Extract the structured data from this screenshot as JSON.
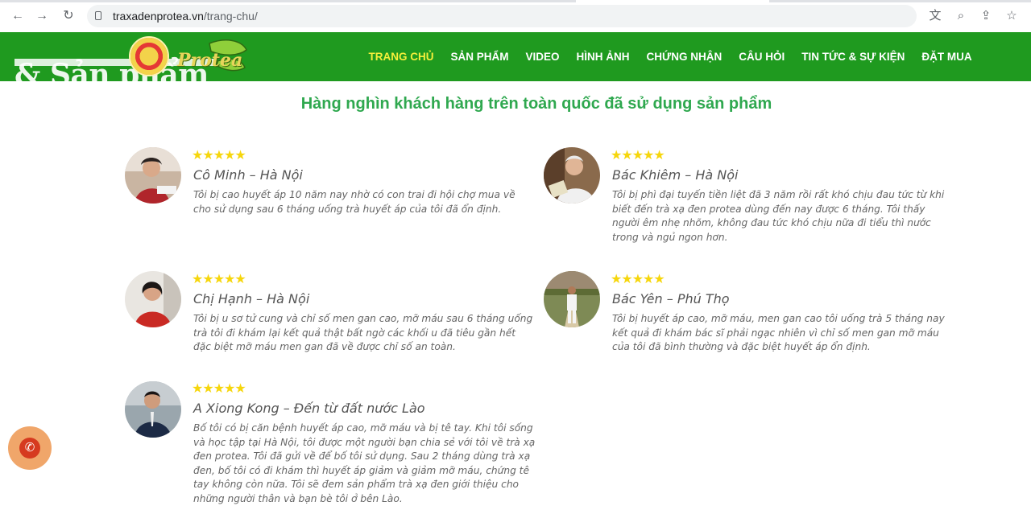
{
  "browser": {
    "url_host": "traxadenprotea.vn",
    "url_path": "/trang-chu/"
  },
  "logo": {
    "tagline": "& Sản phẩm",
    "brand": "Protea"
  },
  "menu": [
    {
      "label": "TRANG CHỦ",
      "active": true
    },
    {
      "label": "SẢN PHẨM",
      "active": false
    },
    {
      "label": "VIDEO",
      "active": false
    },
    {
      "label": "HÌNH ẢNH",
      "active": false
    },
    {
      "label": "CHỨNG NHẬN",
      "active": false
    },
    {
      "label": "CÂU HỎI",
      "active": false
    },
    {
      "label": "TIN TỨC & SỰ KIỆN",
      "active": false
    },
    {
      "label": "ĐẶT MUA",
      "active": false
    }
  ],
  "headline": "Hàng nghìn khách hàng trên toàn quốc đã sử dụng sản phẩm",
  "testimonials": [
    {
      "name": "Cô Minh – Hà Nội",
      "rating": 5,
      "stars": "★★★★★",
      "text": "Tôi bị cao huyết áp 10 năm nay nhờ có con trai đi hội chợ mua về cho sử dụng sau 6 tháng uống trà huyết áp của tôi đã ổn định."
    },
    {
      "name": "Bác Khiêm – Hà Nội",
      "rating": 5,
      "stars": "★★★★★",
      "text": "Tôi bị phì đại tuyến tiền liệt đã 3 năm rồi rất khó chịu đau tức từ khi biết đến trà xạ đen protea dùng đến nay được 6 tháng. Tôi thấy người êm nhẹ nhõm, không đau tức khó chịu nữa đi tiểu thì nước trong và ngủ ngon hơn."
    },
    {
      "name": "Chị Hạnh – Hà Nội",
      "rating": 5,
      "stars": "★★★★★",
      "text": "Tôi bị u sơ tử cung và chỉ số men gan cao, mỡ máu sau 6 tháng uống trà tôi đi khám lại kết quả thật bất ngờ các khối u đã tiêu gần hết đặc biệt mỡ máu men gan đã về được chỉ số an toàn."
    },
    {
      "name": "Bác Yên – Phú Thọ",
      "rating": 5,
      "stars": "★★★★★",
      "text": "Tôi bị huyết áp cao, mỡ máu, men gan cao tôi uống trà 5 tháng nay kết quả đi khám bác sĩ phải ngạc nhiên vì chỉ số men gan mỡ máu của tôi đã bình thường và đặc biệt huyết áp ổn định."
    },
    {
      "name": "A Xiong Kong – Đến từ đất nước Lào",
      "rating": 5,
      "stars": "★★★★★",
      "text": "Bố tôi có bị căn bệnh huyết áp cao, mỡ máu và bị tê tay. Khi tôi sống và học tập tại Hà Nội, tôi được một người bạn chia sẻ với tôi về trà xạ đen protea. Tôi đã gửi về để bố tôi sử dụng. Sau 2 tháng dùng trà xạ đen, bố tôi có đi khám thì huyết áp giảm và giảm mỡ máu, chứng tê tay không còn nữa. Tôi sẽ đem sản phẩm trà xạ đen giới thiệu cho những người thân và bạn bè tôi ở bên Lào."
    }
  ],
  "colors": {
    "header_green": "#1f9a1f",
    "active_menu": "#f5ef3b",
    "headline_green": "#2fa84f",
    "star_yellow": "#f6d60c",
    "call_button": "#d63a1f"
  },
  "icons": [
    "back-icon",
    "forward-icon",
    "reload-icon",
    "site-info-icon",
    "translate-icon",
    "zoom-icon",
    "share-icon",
    "bookmark-star-icon",
    "phone-icon"
  ]
}
